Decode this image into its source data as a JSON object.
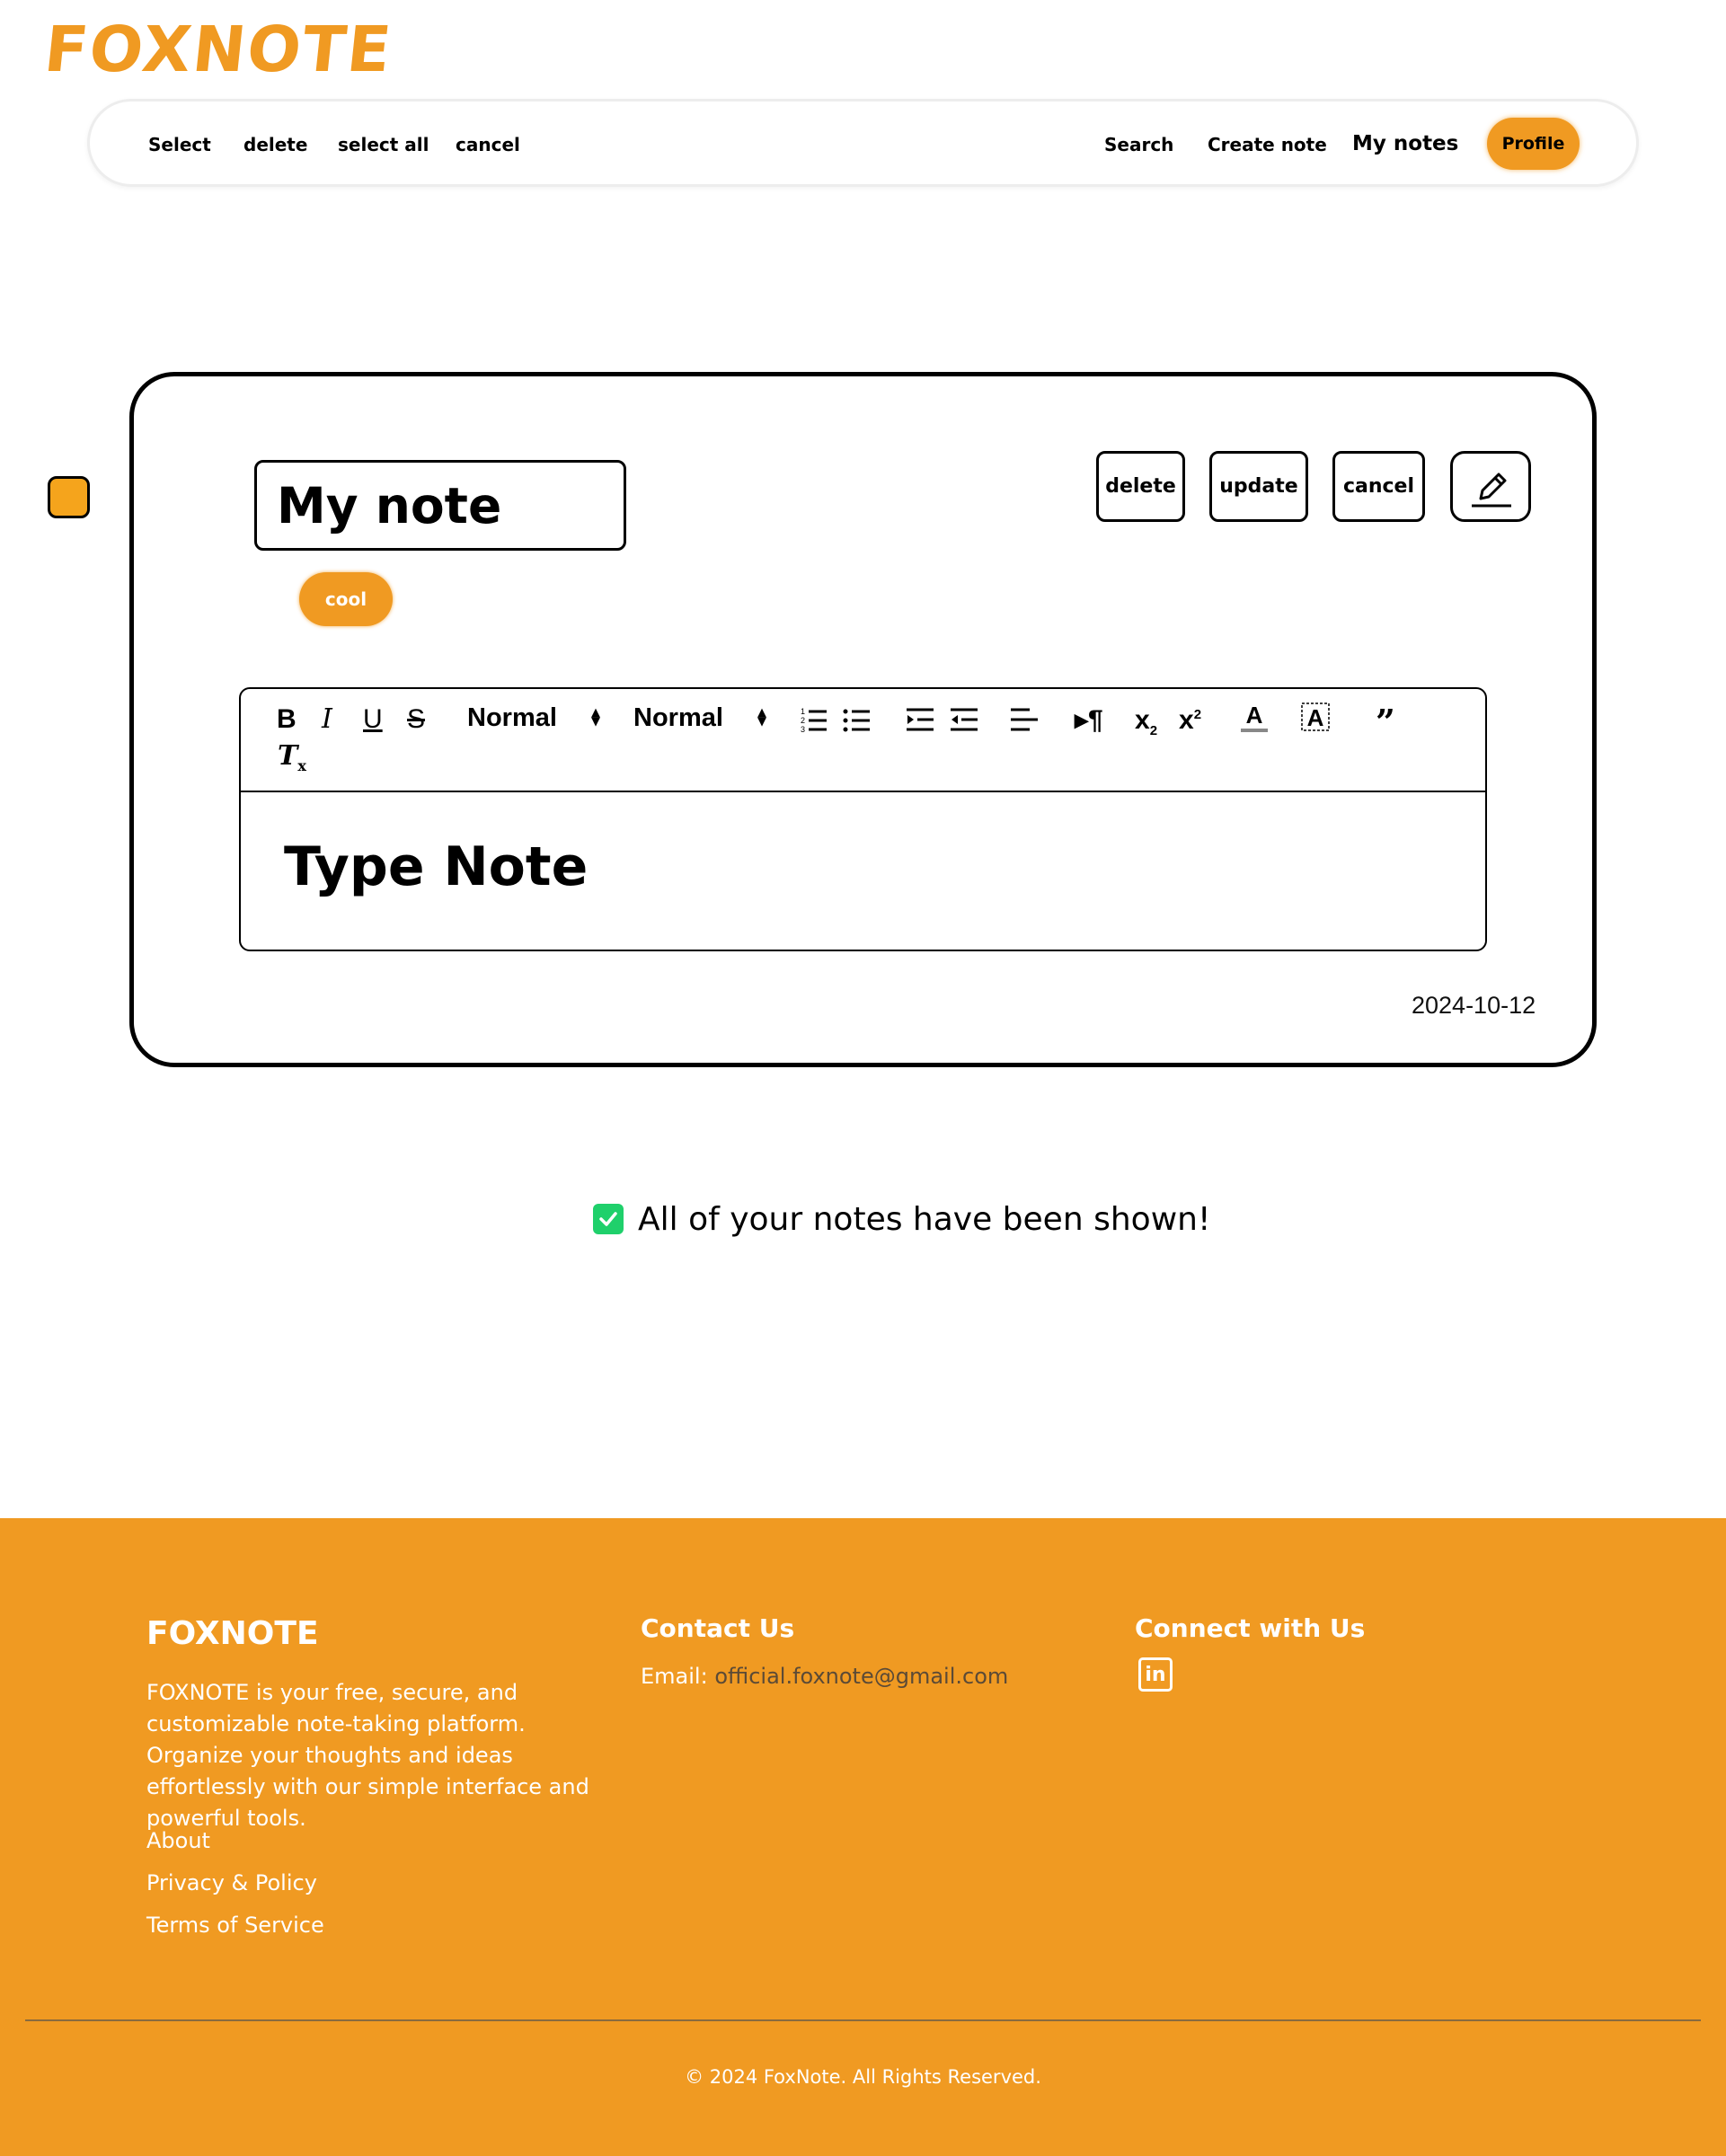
{
  "app": {
    "logo": "FOXNOTE"
  },
  "nav": {
    "left": [
      "Select",
      "delete",
      "select all",
      "cancel"
    ],
    "right": [
      "Search",
      "Create note",
      "My notes"
    ],
    "profile": "Profile"
  },
  "note": {
    "title": "My note",
    "tag": "cool",
    "actions": [
      "delete",
      "update",
      "cancel"
    ],
    "edit_icon": "pencil-icon",
    "toolbar": {
      "font_size": "Normal",
      "heading": "Normal",
      "buttons": [
        "bold",
        "italic",
        "underline",
        "strike",
        "ordered-list",
        "bullet-list",
        "indent",
        "outdent",
        "align",
        "text-direction",
        "subscript",
        "superscript",
        "text-color",
        "background-color",
        "blockquote",
        "clear-format"
      ]
    },
    "body": "Type Note",
    "date": "2024-10-12"
  },
  "status": {
    "message": "All of your notes have been shown!"
  },
  "footer": {
    "brand": "FOXNOTE",
    "description": "FOXNOTE is your free, secure, and customizable note-taking platform. Organize your thoughts and ideas effortlessly with our simple interface and powerful tools.",
    "links": [
      "About",
      "Privacy & Policy",
      "Terms of Service"
    ],
    "contact_heading": "Contact Us",
    "email_label": "Email:",
    "email": "official.foxnote@gmail.com",
    "connect_heading": "Connect with Us",
    "social_icon": "linkedin-icon",
    "copyright": "© 2024 FoxNote. All Rights Reserved."
  },
  "colors": {
    "accent": "#F09A22",
    "success": "#1fd06b"
  }
}
